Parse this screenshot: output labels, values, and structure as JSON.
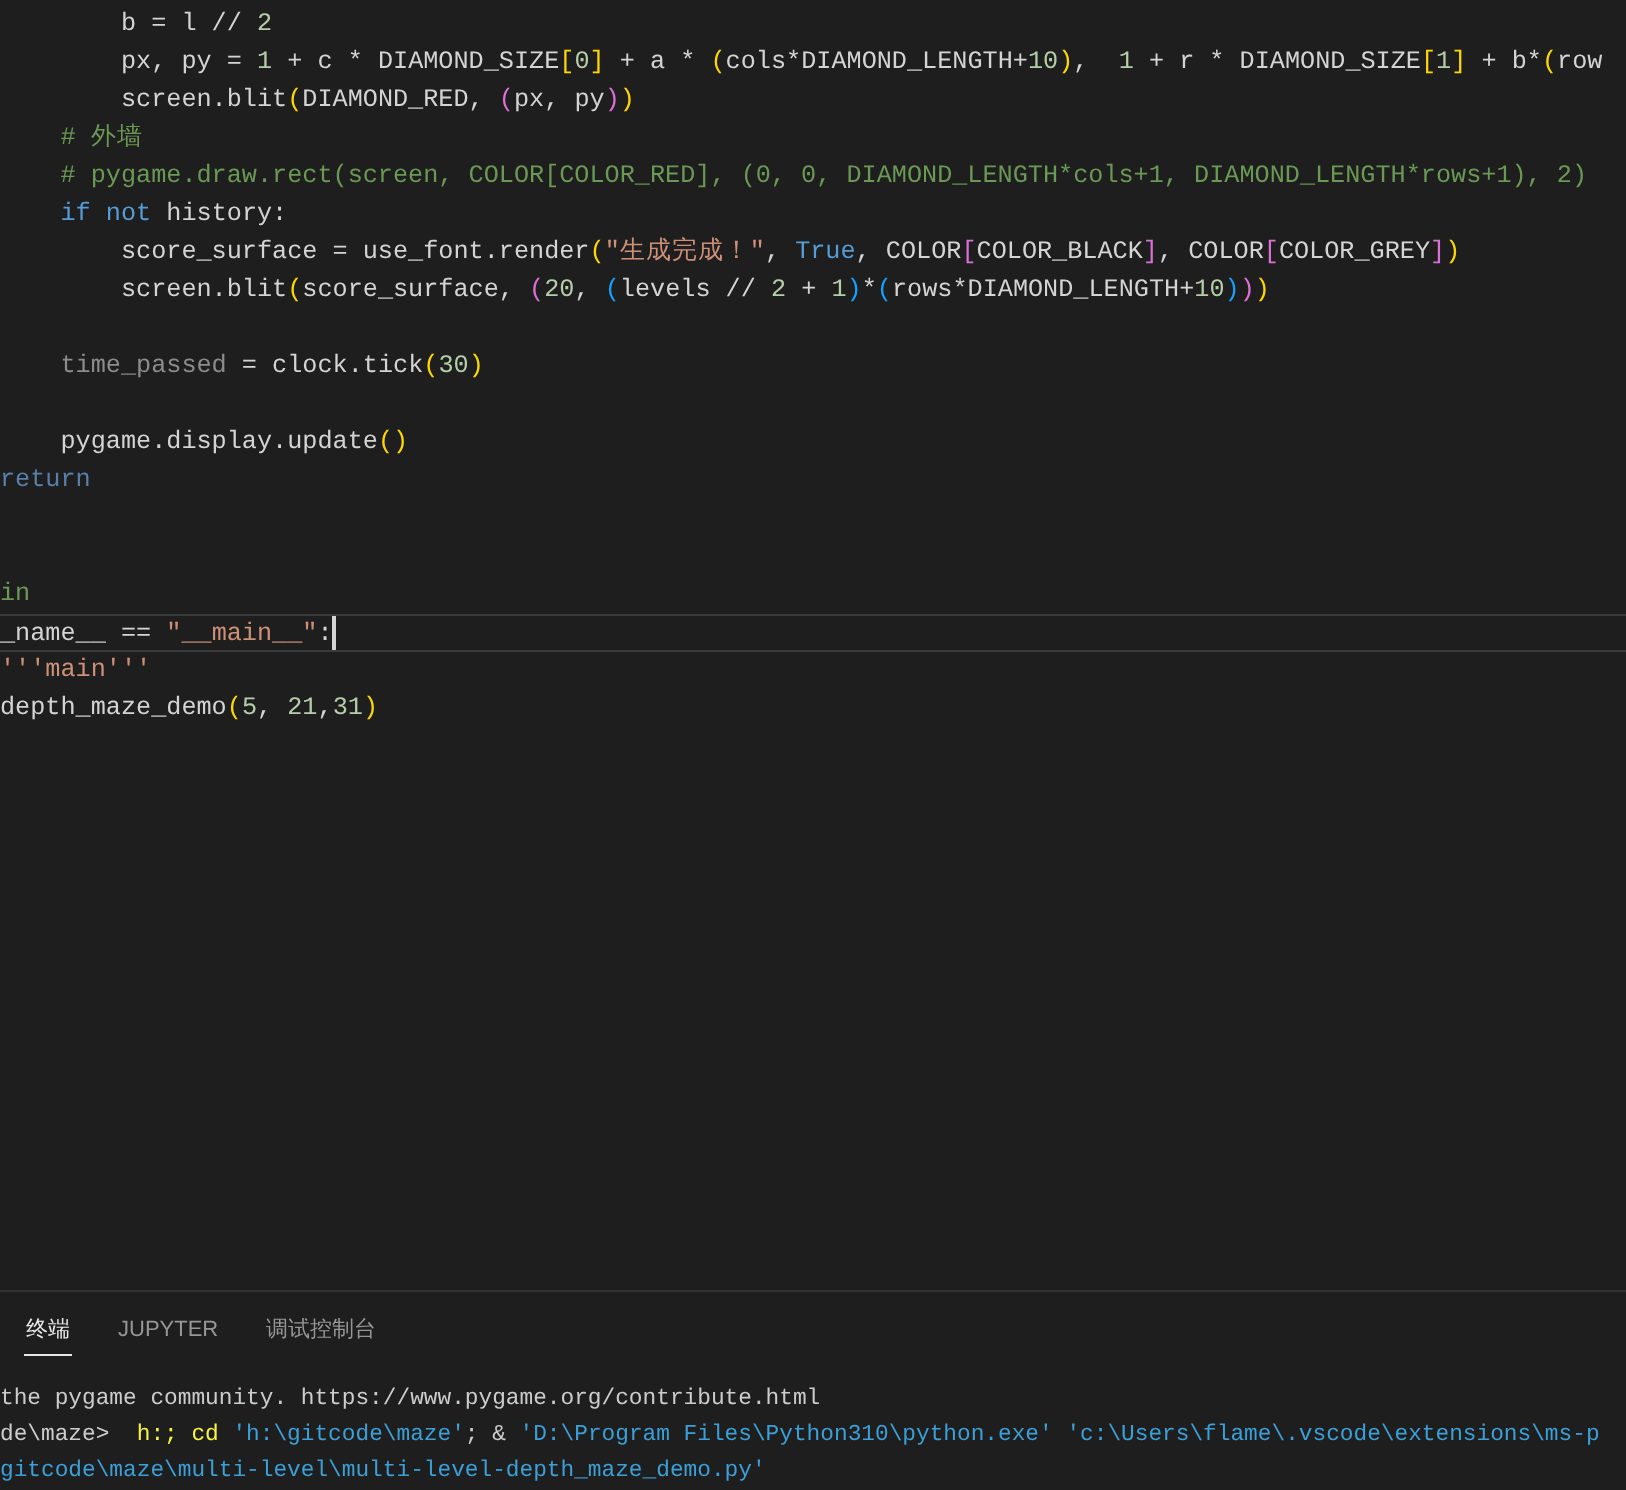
{
  "editor": {
    "lines": [
      {
        "current": false,
        "tokens": [
          {
            "kind": "plain",
            "text": "        b = l // "
          },
          {
            "kind": "number",
            "text": "2"
          }
        ]
      },
      {
        "current": false,
        "tokens": [
          {
            "kind": "plain",
            "text": "        px, py = "
          },
          {
            "kind": "number",
            "text": "1"
          },
          {
            "kind": "plain",
            "text": " + c * DIAMOND_SIZE"
          },
          {
            "kind": "bracket1",
            "text": "["
          },
          {
            "kind": "number",
            "text": "0"
          },
          {
            "kind": "bracket1",
            "text": "]"
          },
          {
            "kind": "plain",
            "text": " + a * "
          },
          {
            "kind": "bracket1",
            "text": "("
          },
          {
            "kind": "plain",
            "text": "cols*DIAMOND_LENGTH+"
          },
          {
            "kind": "number",
            "text": "10"
          },
          {
            "kind": "bracket1",
            "text": ")"
          },
          {
            "kind": "plain",
            "text": ",  "
          },
          {
            "kind": "number",
            "text": "1"
          },
          {
            "kind": "plain",
            "text": " + r * DIAMOND_SIZE"
          },
          {
            "kind": "bracket1",
            "text": "["
          },
          {
            "kind": "number",
            "text": "1"
          },
          {
            "kind": "bracket1",
            "text": "]"
          },
          {
            "kind": "plain",
            "text": " + b*"
          },
          {
            "kind": "bracket1",
            "text": "("
          },
          {
            "kind": "plain",
            "text": "row"
          }
        ]
      },
      {
        "current": false,
        "tokens": [
          {
            "kind": "plain",
            "text": "        screen.blit"
          },
          {
            "kind": "bracket1",
            "text": "("
          },
          {
            "kind": "plain",
            "text": "DIAMOND_RED, "
          },
          {
            "kind": "bracket2",
            "text": "("
          },
          {
            "kind": "plain",
            "text": "px, py"
          },
          {
            "kind": "bracket2",
            "text": ")"
          },
          {
            "kind": "bracket1",
            "text": ")"
          }
        ]
      },
      {
        "current": false,
        "tokens": [
          {
            "kind": "comment",
            "text": "    # 外墙"
          }
        ]
      },
      {
        "current": false,
        "tokens": [
          {
            "kind": "comment",
            "text": "    # pygame.draw.rect(screen, COLOR[COLOR_RED], (0, 0, DIAMOND_LENGTH*cols+1, DIAMOND_LENGTH*rows+1), 2)"
          }
        ]
      },
      {
        "current": false,
        "tokens": [
          {
            "kind": "keyword",
            "text": "    if"
          },
          {
            "kind": "keyword",
            "text": " not"
          },
          {
            "kind": "plain",
            "text": " history:"
          }
        ]
      },
      {
        "current": false,
        "tokens": [
          {
            "kind": "plain",
            "text": "        score_surface = use_font.render"
          },
          {
            "kind": "bracket1",
            "text": "("
          },
          {
            "kind": "string",
            "text": "\"生成完成！\""
          },
          {
            "kind": "plain",
            "text": ", "
          },
          {
            "kind": "keyword",
            "text": "True"
          },
          {
            "kind": "plain",
            "text": ", COLOR"
          },
          {
            "kind": "bracket2",
            "text": "["
          },
          {
            "kind": "plain",
            "text": "COLOR_BLACK"
          },
          {
            "kind": "bracket2",
            "text": "]"
          },
          {
            "kind": "plain",
            "text": ", COLOR"
          },
          {
            "kind": "bracket2",
            "text": "["
          },
          {
            "kind": "plain",
            "text": "COLOR_GREY"
          },
          {
            "kind": "bracket2",
            "text": "]"
          },
          {
            "kind": "bracket1",
            "text": ")"
          }
        ]
      },
      {
        "current": false,
        "tokens": [
          {
            "kind": "plain",
            "text": "        screen.blit"
          },
          {
            "kind": "bracket1",
            "text": "("
          },
          {
            "kind": "plain",
            "text": "score_surface, "
          },
          {
            "kind": "bracket2",
            "text": "("
          },
          {
            "kind": "number",
            "text": "20"
          },
          {
            "kind": "plain",
            "text": ", "
          },
          {
            "kind": "bracket3",
            "text": "("
          },
          {
            "kind": "plain",
            "text": "levels // "
          },
          {
            "kind": "number",
            "text": "2"
          },
          {
            "kind": "plain",
            "text": " + "
          },
          {
            "kind": "number",
            "text": "1"
          },
          {
            "kind": "bracket3",
            "text": ")"
          },
          {
            "kind": "plain",
            "text": "*"
          },
          {
            "kind": "bracket3",
            "text": "("
          },
          {
            "kind": "plain",
            "text": "rows*DIAMOND_LENGTH+"
          },
          {
            "kind": "number",
            "text": "10"
          },
          {
            "kind": "bracket3",
            "text": ")"
          },
          {
            "kind": "bracket2",
            "text": ")"
          },
          {
            "kind": "bracket1",
            "text": ")"
          }
        ]
      },
      {
        "current": false
      },
      {
        "current": false,
        "tokens": [
          {
            "kind": "unused",
            "text": "    time_passed"
          },
          {
            "kind": "plain",
            "text": " = clock.tick"
          },
          {
            "kind": "bracket1",
            "text": "("
          },
          {
            "kind": "number",
            "text": "30"
          },
          {
            "kind": "bracket1",
            "text": ")"
          }
        ]
      },
      {
        "current": false
      },
      {
        "current": false,
        "tokens": [
          {
            "kind": "plain",
            "text": "    pygame.display.update"
          },
          {
            "kind": "bracket1",
            "text": "()"
          }
        ]
      },
      {
        "current": false,
        "tokens": [
          {
            "kind": "muted",
            "text": "return"
          }
        ]
      },
      {
        "current": false
      },
      {
        "current": false
      },
      {
        "current": false,
        "tokens": [
          {
            "kind": "comment",
            "text": "in"
          }
        ]
      },
      {
        "current": true,
        "tokens": [
          {
            "kind": "plain",
            "text": "_name__ == "
          },
          {
            "kind": "string",
            "text": "\"__main__\""
          },
          {
            "kind": "plain",
            "text": ":"
          }
        ]
      },
      {
        "current": false,
        "tokens": [
          {
            "kind": "string",
            "text": "'''main'''"
          }
        ]
      },
      {
        "current": false,
        "tokens": [
          {
            "kind": "plain",
            "text": "depth_maze_demo"
          },
          {
            "kind": "bracket1",
            "text": "("
          },
          {
            "kind": "number",
            "text": "5"
          },
          {
            "kind": "plain",
            "text": ", "
          },
          {
            "kind": "number",
            "text": "21"
          },
          {
            "kind": "plain",
            "text": ","
          },
          {
            "kind": "number",
            "text": "31"
          },
          {
            "kind": "bracket1",
            "text": ")"
          }
        ]
      }
    ]
  },
  "panel": {
    "tabs": [
      {
        "label": "终端",
        "selected": true
      },
      {
        "label": "JUPYTER",
        "selected": false
      },
      {
        "label": "调试控制台",
        "selected": false
      }
    ],
    "terminal_lines": [
      {
        "tokens": [
          {
            "kind": "plain",
            "text": "the pygame community. https://www.pygame.org/contribute.html"
          }
        ]
      },
      {
        "tokens": [
          {
            "kind": "plain",
            "text": "de\\maze>  "
          },
          {
            "kind": "command",
            "text": "h:; cd"
          },
          {
            "kind": "string",
            "text": " 'h:\\gitcode\\maze'"
          },
          {
            "kind": "plain",
            "text": "; & "
          },
          {
            "kind": "string",
            "text": "'D:\\Program Files\\Python310\\python.exe'"
          },
          {
            "kind": "string",
            "text": " 'c:\\Users\\flame\\.vscode\\extensions\\ms-p"
          }
        ]
      },
      {
        "tokens": [
          {
            "kind": "string",
            "text": "gitcode\\maze\\multi-level\\multi-level-depth_maze_demo.py'"
          }
        ]
      }
    ]
  }
}
